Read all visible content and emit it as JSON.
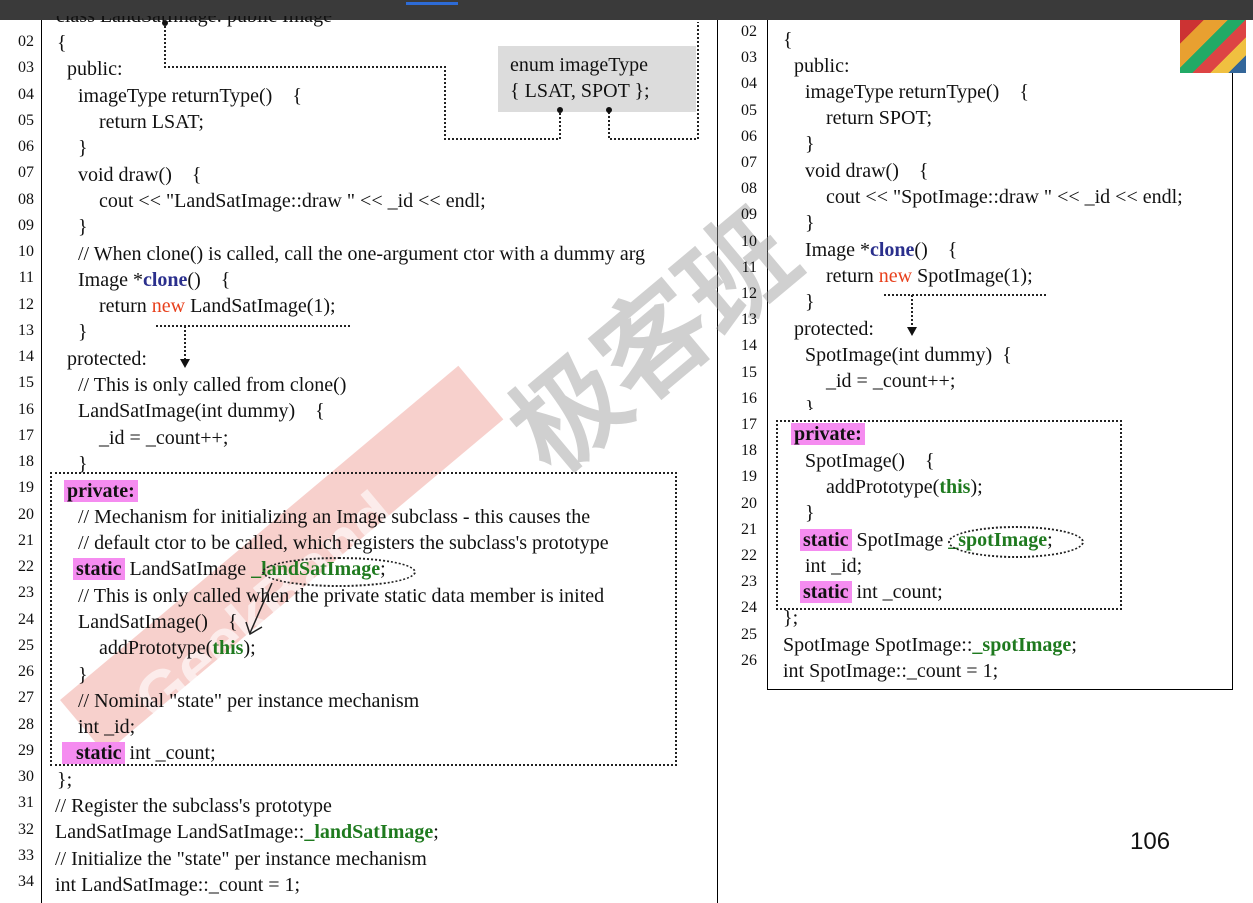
{
  "left": {
    "line_numbers": [
      "02",
      "03",
      "04",
      "05",
      "06",
      "07",
      "08",
      "09",
      "10",
      "11",
      "12",
      "13",
      "14",
      "15",
      "16",
      "17",
      "18",
      "19",
      "20",
      "21",
      "22",
      "23",
      "24",
      "25",
      "26",
      "27",
      "28",
      "29",
      "30",
      "31",
      "32",
      "33",
      "34"
    ],
    "header_partial": "class LandSatImage: public Image",
    "lines": {
      "l02": "{",
      "l03": "public:",
      "l04": "imageType returnType()    {",
      "l05": "return LSAT;",
      "l06": "}",
      "l07": "void draw()    {",
      "l08": "cout << \"LandSatImage::draw \" << _id << endl;",
      "l09": "}",
      "l10": "// When clone() is called, call the one-argument ctor with a dummy arg",
      "l11_a": "Image *",
      "l11_b": "clone",
      "l11_c": "()    {",
      "l12_a": "return ",
      "l12_b": "new",
      "l12_c": " LandSatImage(1);",
      "l13": "}",
      "l14": "protected:",
      "l15": "// This is only called from clone()",
      "l16": "LandSatImage(int dummy)    {",
      "l17": "_id = _count++;",
      "l18": "}",
      "l19": "private:",
      "l20": "// Mechanism for initializing an Image subclass - this causes the",
      "l21": "// default ctor to be called, which registers the subclass's prototype",
      "l22_a": "static",
      "l22_b": " LandSatImage ",
      "l22_c": "_landSatImage",
      "l22_d": ";",
      "l23": "// This is only called when the private static data member is inited",
      "l24": "LandSatImage()    {",
      "l25_a": "addPrototype(",
      "l25_b": "this",
      "l25_c": ");",
      "l26": "}",
      "l27": "// Nominal \"state\" per instance mechanism",
      "l28": "int _id;",
      "l29_a": "static",
      "l29_b": " int _count;",
      "l30": "};",
      "l31": "// Register the subclass's prototype",
      "l32_a": "LandSatImage LandSatImage::",
      "l32_b": "_landSatImage",
      "l32_c": ";",
      "l33": "// Initialize the \"state\" per instance mechanism",
      "l34": "int LandSatImage::_count = 1;"
    }
  },
  "enum_box": {
    "line1": "enum imageType",
    "line2": "{ LSAT, SPOT  };"
  },
  "right": {
    "line_numbers": [
      "02",
      "03",
      "04",
      "05",
      "06",
      "07",
      "08",
      "09",
      "10",
      "11",
      "12",
      "13",
      "14",
      "15",
      "16",
      "17",
      "18",
      "19",
      "20",
      "21",
      "22",
      "23",
      "24",
      "25",
      "26"
    ],
    "lines": {
      "r02": "{",
      "r03": "public:",
      "r04": "imageType returnType()    {",
      "r05": "return SPOT;",
      "r06": "}",
      "r07": "void draw()    {",
      "r08": "cout << \"SpotImage::draw \" << _id << endl;",
      "r09": "}",
      "r10_a": "Image *",
      "r10_b": "clone",
      "r10_c": "()    {",
      "r11_a": "return ",
      "r11_b": "new",
      "r11_c": " SpotImage(1);",
      "r12": "}",
      "r13": "protected:",
      "r14": "SpotImage(int dummy)  {",
      "r15": "_id = _count++;",
      "r16": "}",
      "r17": "private:",
      "r18": "SpotImage()    {",
      "r19_a": "addPrototype(",
      "r19_b": "this",
      "r19_c": ");",
      "r20": "}",
      "r21_a": "static",
      "r21_b": " SpotImage ",
      "r21_c": "_spotImage",
      "r21_d": ";",
      "r22": "int _id;",
      "r23_a": "static",
      "r23_b": " int _count;",
      "r24": "};",
      "r25_a": "SpotImage SpotImage::",
      "r25_b": "_spotImage",
      "r25_c": ";",
      "r26": "int SpotImage::_count = 1;"
    }
  },
  "page_number": "106",
  "watermark": {
    "cn": "极客班",
    "en": "GeekBand"
  },
  "colors": {
    "highlight_pink": "#f58cf0",
    "green": "#1f7a1f",
    "new_red": "#e8401c",
    "clone_blue": "#2a2f8c",
    "enum_bg": "#dcdcdc"
  }
}
